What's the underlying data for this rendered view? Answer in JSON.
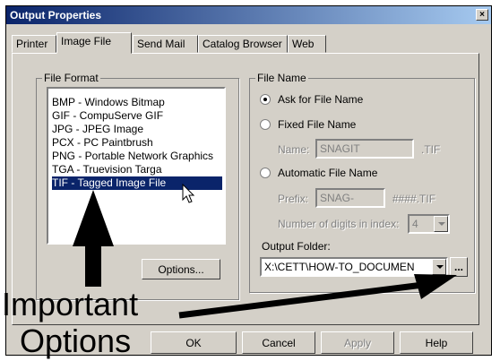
{
  "window": {
    "title": "Output Properties",
    "close_glyph": "×"
  },
  "tabs": [
    {
      "label": "Printer"
    },
    {
      "label": "Image File"
    },
    {
      "label": "Send Mail"
    },
    {
      "label": "Catalog Browser"
    },
    {
      "label": "Web"
    }
  ],
  "file_format": {
    "legend": "File Format",
    "items": [
      "BMP - Windows Bitmap",
      "GIF - CompuServe GIF",
      "JPG - JPEG Image",
      "PCX - PC Paintbrush",
      "PNG - Portable Network Graphics",
      "TGA - Truevision Targa",
      "TIF - Tagged Image File"
    ],
    "selected_index": 6,
    "options_button": "Options..."
  },
  "file_name": {
    "legend": "File Name",
    "ask_label": "Ask for File Name",
    "fixed_label": "Fixed File Name",
    "name_label": "Name:",
    "name_value": "SNAGIT",
    "name_ext": ".TIF",
    "auto_label": "Automatic File Name",
    "prefix_label": "Prefix:",
    "prefix_value": "SNAG-",
    "prefix_ext": "####.TIF",
    "digits_label": "Number of digits in index:",
    "digits_value": "4",
    "output_folder_label": "Output Folder:",
    "output_folder_value": "X:\\CETT\\HOW-TO_DOCUMEN",
    "browse_label": "..."
  },
  "buttons": {
    "ok": "OK",
    "cancel": "Cancel",
    "apply": "Apply",
    "help": "Help"
  },
  "annotation": {
    "line1": "Important",
    "line2": "Options"
  },
  "colors": {
    "selection": "#0a246a",
    "face": "#d4d0c8"
  }
}
